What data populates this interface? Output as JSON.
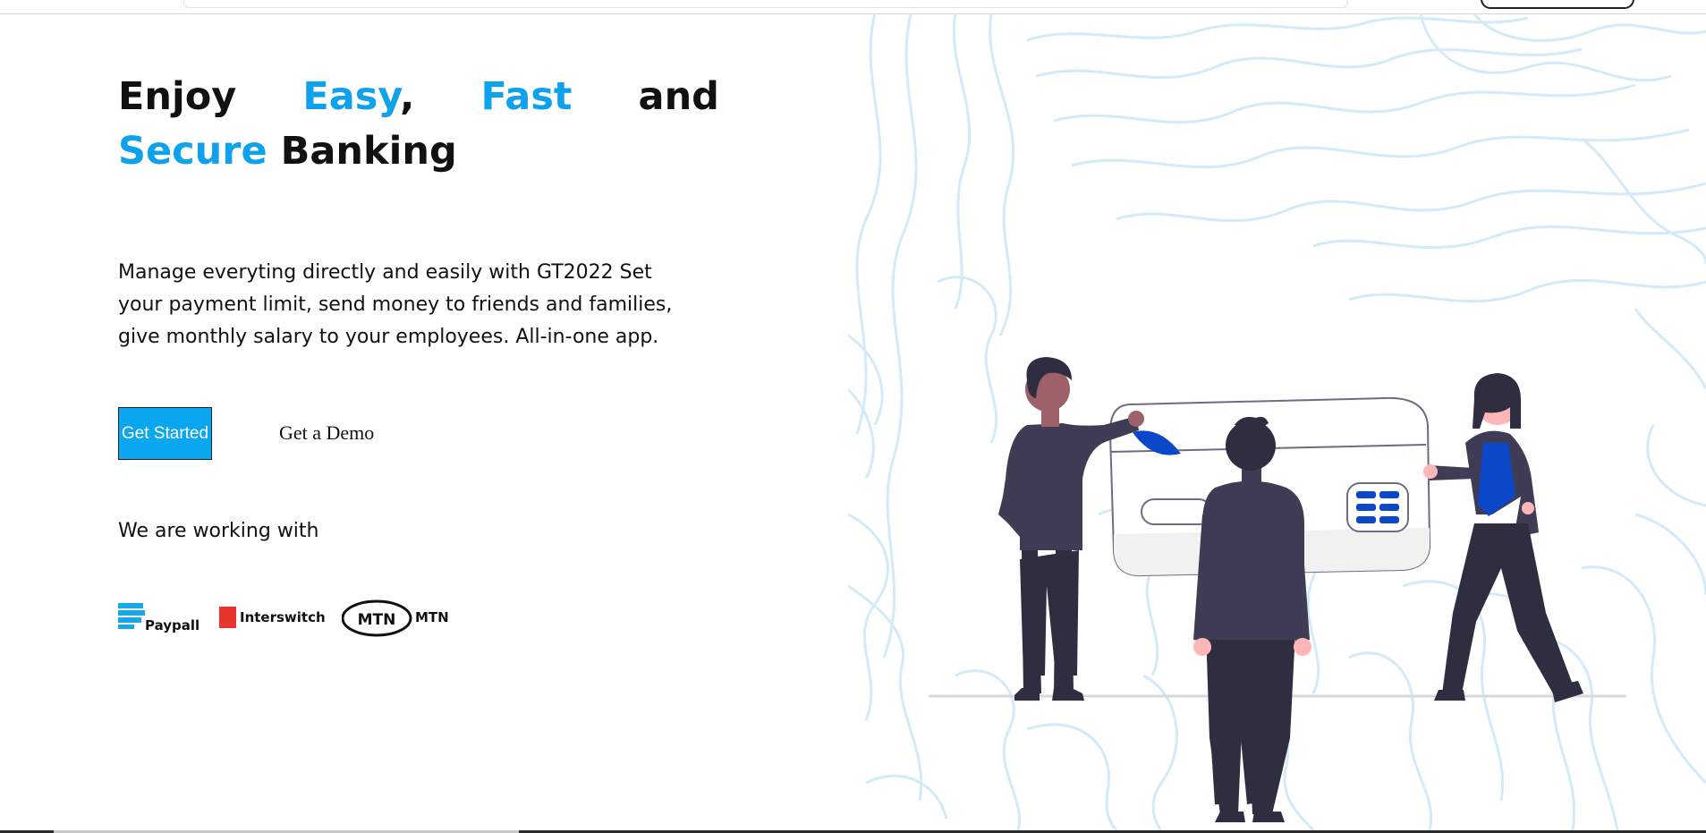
{
  "hero": {
    "title_words": [
      "Enjoy",
      "Easy",
      ",",
      "Fast",
      "and",
      "Secure",
      "Banking"
    ],
    "accent_color": "#0ea2ec",
    "description": "Manage everyting directly and easily with GT2022 Set your payment limit, send money to friends and families, give monthly salary to your employees. All-in-one app."
  },
  "actions": {
    "get_started_label": "Get Started",
    "get_demo_label": "Get a Demo",
    "primary_color": "#0aa6f0"
  },
  "partners": {
    "heading": "We are working with",
    "items": [
      {
        "label": "Paypall",
        "icon": "stacked-bars-icon",
        "color": "#16a9e8"
      },
      {
        "label": "Interswitch",
        "icon": "red-square-icon",
        "color": "#e8352b"
      },
      {
        "label": "MTN",
        "icon": "mtn-oval-logo",
        "logo_text": "MTN",
        "color": "#111111"
      }
    ]
  },
  "illustration": {
    "description_icon": "team-credit-card-illustration",
    "line_color": "#cfe9f8",
    "figure_dark": "#3f3d56",
    "accent_blue": "#0a47c9"
  }
}
